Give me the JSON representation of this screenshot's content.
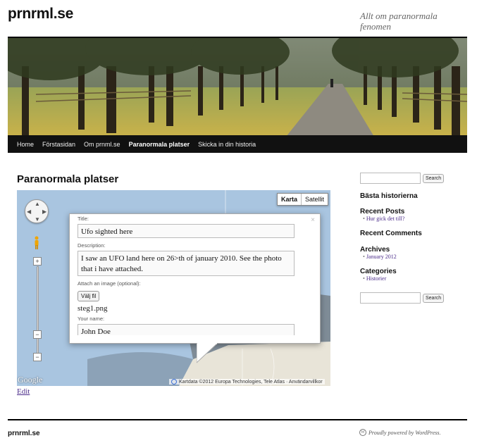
{
  "site": {
    "title": "prnrml.se",
    "description": "Allt om paranormala fenomen"
  },
  "nav": {
    "items": [
      "Home",
      "Förstasidan",
      "Om prnml.se",
      "Paranormala platser",
      "Skicka in din historia"
    ],
    "active_index": 3
  },
  "page": {
    "title": "Paranormala platser",
    "edit_label": "Edit"
  },
  "map": {
    "type_buttons": [
      "Karta",
      "Satellit"
    ],
    "selected_type": "Karta",
    "zoom_in": "+",
    "zoom_out": "−",
    "zoom_min": "−",
    "logo": "Google",
    "attribution": "Kartdata ©2012 Europa Technologies, Tele Atlas · Användarvillkor",
    "pan_icon": "pan-control-icon",
    "pegman_icon": "street-view-pegman-icon"
  },
  "form": {
    "title_label": "Title:",
    "title_value": "Ufo sighted here",
    "description_label": "Description:",
    "description_value": "I saw an UFO land here on 26>th of january 2010. See the photo that i have attached.",
    "attach_label": "Attach an image (optional):",
    "file_button": "Välj fil",
    "file_name": "steg1.png",
    "name_label": "Your name:",
    "name_value": "John Doe",
    "close_symbol": "×"
  },
  "sidebar": {
    "search_button": "Search",
    "best_stories_title": "Bästa historierna",
    "recent_posts_title": "Recent Posts",
    "recent_posts": [
      "Hur gick det till?"
    ],
    "recent_comments_title": "Recent Comments",
    "archives_title": "Archives",
    "archives": [
      "January 2012"
    ],
    "categories_title": "Categories",
    "categories": [
      "Historier"
    ],
    "search_button_2": "Search"
  },
  "footer": {
    "site_name": "prnrml.se",
    "powered": "Proudly powered by WordPress."
  }
}
